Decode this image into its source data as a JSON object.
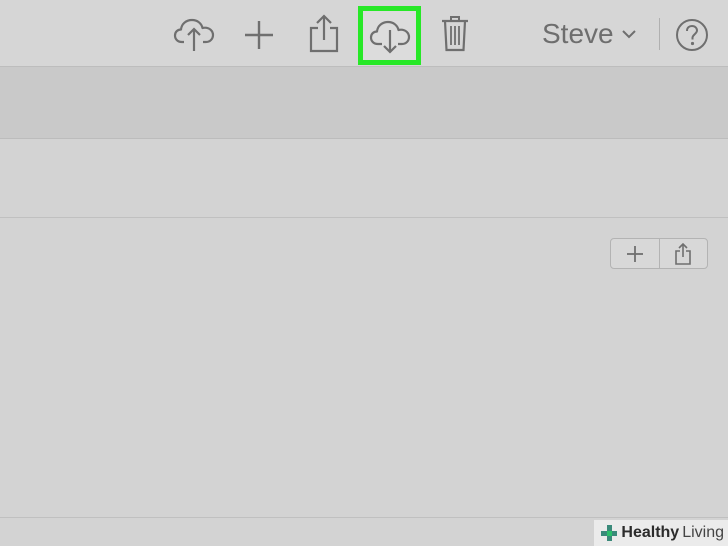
{
  "toolbar": {
    "buttons": [
      {
        "name": "upload",
        "icon": "cloud-upload-icon"
      },
      {
        "name": "new",
        "icon": "plus-icon"
      },
      {
        "name": "share",
        "icon": "share-icon"
      },
      {
        "name": "download",
        "icon": "cloud-download-icon",
        "highlighted": true,
        "highlight_color": "#27e827"
      },
      {
        "name": "delete",
        "icon": "trash-icon"
      }
    ],
    "user_name": "Steve",
    "user_menu_icon": "chevron-down-icon",
    "help_icon": "help-icon"
  },
  "section_actions": [
    {
      "name": "add",
      "icon": "plus-icon"
    },
    {
      "name": "share",
      "icon": "share-icon"
    }
  ],
  "watermark": {
    "bold_text": "Healthy",
    "light_text": "Living",
    "icon": "green-cross-icon"
  },
  "colors": {
    "highlight": "#27e827",
    "icon_gray": "#6f6f6f",
    "background": "#d2d2d2"
  }
}
